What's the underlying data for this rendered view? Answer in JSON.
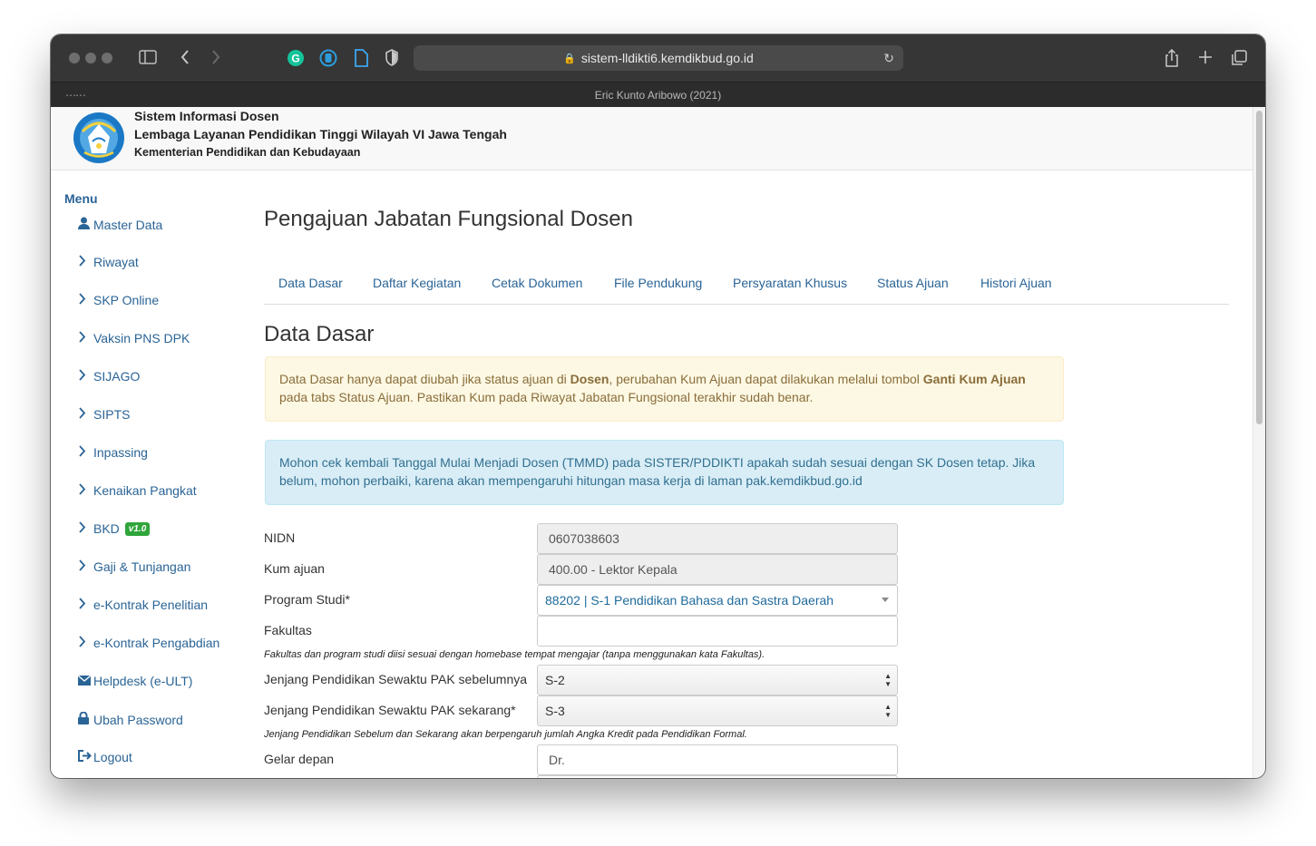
{
  "browser": {
    "url": "sistem-lldikti6.kemdikbud.go.id",
    "tab_title": "Eric Kunto Aribowo (2021)"
  },
  "header": {
    "line1": "Sistem Informasi Dosen",
    "line2": "Lembaga Layanan Pendidikan Tinggi Wilayah VI Jawa Tengah",
    "line3": "Kementerian Pendidikan dan Kebudayaan"
  },
  "sidebar": {
    "title": "Menu",
    "items": [
      {
        "label": "Master Data",
        "icon": "user-icon"
      },
      {
        "label": "Riwayat",
        "icon": "chevron-right-icon"
      },
      {
        "label": "SKP Online",
        "icon": "chevron-right-icon"
      },
      {
        "label": "Vaksin PNS DPK",
        "icon": "chevron-right-icon"
      },
      {
        "label": "SIJAGO",
        "icon": "chevron-right-icon"
      },
      {
        "label": "SIPTS",
        "icon": "chevron-right-icon"
      },
      {
        "label": "Inpassing",
        "icon": "chevron-right-icon"
      },
      {
        "label": "Kenaikan Pangkat",
        "icon": "chevron-right-icon"
      },
      {
        "label": "BKD",
        "icon": "chevron-right-icon",
        "badge": "v1.0"
      },
      {
        "label": "Gaji & Tunjangan",
        "icon": "chevron-right-icon"
      },
      {
        "label": "e-Kontrak Penelitian",
        "icon": "chevron-right-icon"
      },
      {
        "label": "e-Kontrak Pengabdian",
        "icon": "chevron-right-icon"
      },
      {
        "label": "Helpdesk (e-ULT)",
        "icon": "envelope-icon"
      },
      {
        "label": "Ubah Password",
        "icon": "lock-icon"
      },
      {
        "label": "Logout",
        "icon": "logout-icon"
      }
    ]
  },
  "main": {
    "page_title": "Pengajuan Jabatan Fungsional Dosen",
    "tabs": [
      "Data Dasar",
      "Daftar Kegiatan",
      "Cetak Dokumen",
      "File Pendukung",
      "Persyaratan Khusus",
      "Status Ajuan",
      "Histori Ajuan"
    ],
    "section_title": "Data Dasar",
    "warning": {
      "t1": "Data Dasar hanya dapat diubah jika status ajuan di ",
      "b1": "Dosen",
      "t2": ", perubahan Kum Ajuan dapat dilakukan melalui tombol ",
      "b2": "Ganti Kum Ajuan",
      "t3": " pada tabs Status Ajuan. Pastikan Kum pada Riwayat Jabatan Fungsional terakhir sudah benar."
    },
    "info": "Mohon cek kembali Tanggal Mulai Menjadi Dosen (TMMD) pada SISTER/PDDIKTI apakah sudah sesuai dengan SK Dosen tetap. Jika belum, mohon perbaiki, karena akan mempengaruhi hitungan masa kerja di laman pak.kemdikbud.go.id"
  },
  "form": {
    "nidn": {
      "label": "NIDN",
      "value": "0607038603"
    },
    "kum": {
      "label": "Kum ajuan",
      "value": "400.00 - Lektor Kepala"
    },
    "prodi": {
      "label": "Program Studi*",
      "value": "88202 | S-1 Pendidikan Bahasa dan Sastra Daerah"
    },
    "fakultas": {
      "label": "Fakultas",
      "value": ""
    },
    "help1": "Fakultas dan program studi diisi sesuai dengan homebase tempat mengajar (tanpa menggunakan kata Fakultas).",
    "jenjang_sebelum": {
      "label": "Jenjang Pendidikan Sewaktu PAK sebelumnya",
      "value": "S-2"
    },
    "jenjang_sekarang": {
      "label": "Jenjang Pendidikan Sewaktu PAK sekarang*",
      "value": "S-3"
    },
    "help2": "Jenjang Pendidikan Sebelum dan Sekarang akan berpengaruh jumlah Angka Kredit pada Pendidikan Formal.",
    "gelar_depan": {
      "label": "Gelar depan",
      "value": "Dr."
    }
  },
  "colors": {
    "link": "#2a6496",
    "warning_bg": "#fcf8e3",
    "info_bg": "#d9edf7",
    "badge": "#2fa53a"
  }
}
